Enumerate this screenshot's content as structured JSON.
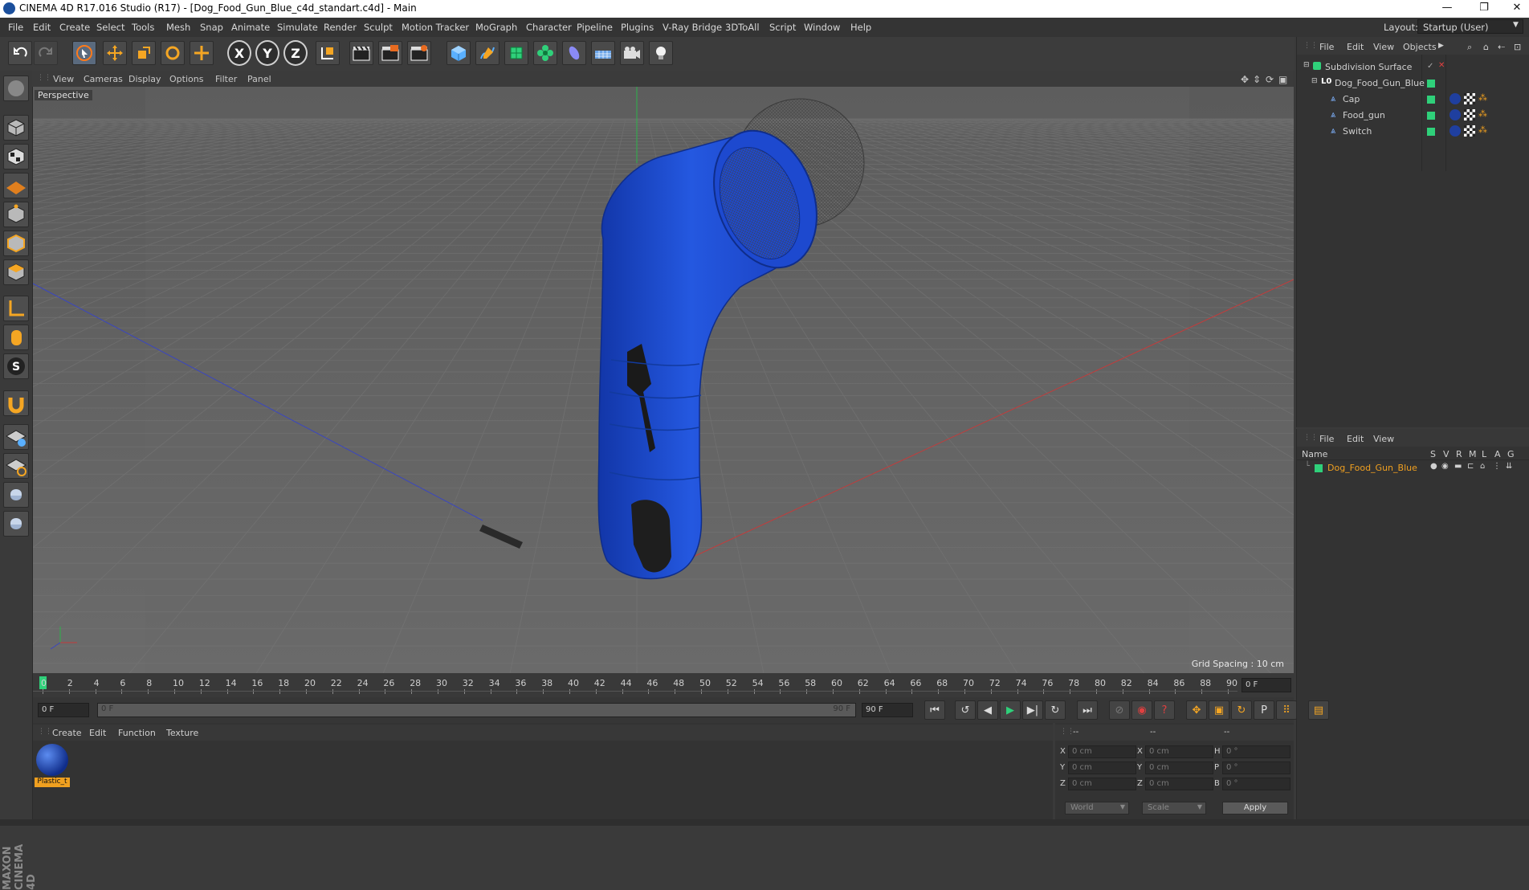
{
  "window": {
    "title": "CINEMA 4D R17.016 Studio (R17) - [Dog_Food_Gun_Blue_c4d_standart.c4d] - Main",
    "controls": [
      "—",
      "❐",
      "✕"
    ]
  },
  "menubar": [
    "File",
    "Edit",
    "Create",
    "Select",
    "Tools",
    "Mesh",
    "Snap",
    "Animate",
    "Simulate",
    "Render",
    "Sculpt",
    "Motion Tracker",
    "MoGraph",
    "Character",
    "Pipeline",
    "Plugins",
    "V-Ray Bridge",
    "3DToAll",
    "Script",
    "Window",
    "Help"
  ],
  "layout": {
    "label": "Layout:",
    "value": "Startup (User)"
  },
  "toolbar": {
    "axis_x": "X",
    "axis_y": "Y",
    "axis_z": "Z"
  },
  "viewport": {
    "menu": [
      "View",
      "Cameras",
      "Display",
      "Options",
      "Filter",
      "Panel"
    ],
    "label": "Perspective",
    "grid_spacing": "Grid Spacing : 10 cm"
  },
  "object_manager": {
    "menu": [
      "File",
      "Edit",
      "View",
      "Objects"
    ],
    "objects": [
      {
        "name": "Subdivision Surface",
        "level": 0
      },
      {
        "name": "Dog_Food_Gun_Blue",
        "level": 1
      },
      {
        "name": "Cap",
        "level": 2
      },
      {
        "name": "Food_gun",
        "level": 2
      },
      {
        "name": "Switch",
        "level": 2
      }
    ]
  },
  "attribute_manager": {
    "menu": [
      "File",
      "Edit",
      "View"
    ],
    "columns": [
      "Name",
      "S",
      "V",
      "R",
      "M",
      "L",
      "A",
      "G"
    ],
    "row": "Dog_Food_Gun_Blue"
  },
  "timeline": {
    "ticks": [
      "0",
      "2",
      "4",
      "6",
      "8",
      "10",
      "12",
      "14",
      "16",
      "18",
      "20",
      "22",
      "24",
      "26",
      "28",
      "30",
      "32",
      "34",
      "36",
      "38",
      "40",
      "42",
      "44",
      "46",
      "48",
      "50",
      "52",
      "54",
      "56",
      "58",
      "60",
      "62",
      "64",
      "66",
      "68",
      "70",
      "72",
      "74",
      "76",
      "78",
      "80",
      "82",
      "84",
      "86",
      "88",
      "90"
    ],
    "frame_field": "0 F",
    "start": "0 F",
    "range_start": "0 F",
    "range_end": "90 F",
    "end": "90 F"
  },
  "material_manager": {
    "menu": [
      "Create",
      "Edit",
      "Function",
      "Texture"
    ],
    "material": "Plastic_t"
  },
  "coordinates": {
    "header": [
      "--",
      "--",
      "--"
    ],
    "rows": [
      {
        "a": "X",
        "av": "0 cm",
        "b": "X",
        "bv": "0 cm",
        "c": "H",
        "cv": "0 °"
      },
      {
        "a": "Y",
        "av": "0 cm",
        "b": "Y",
        "bv": "0 cm",
        "c": "P",
        "cv": "0 °"
      },
      {
        "a": "Z",
        "av": "0 cm",
        "b": "Z",
        "bv": "0 cm",
        "c": "B",
        "cv": "0 °"
      }
    ],
    "mode1": "World",
    "mode2": "Scale",
    "apply": "Apply"
  },
  "brand": "MAXON CINEMA 4D",
  "colors": {
    "accent_green": "#2fd07a",
    "model_blue": "#1f4fd6",
    "selection_orange": "#f0a020"
  }
}
